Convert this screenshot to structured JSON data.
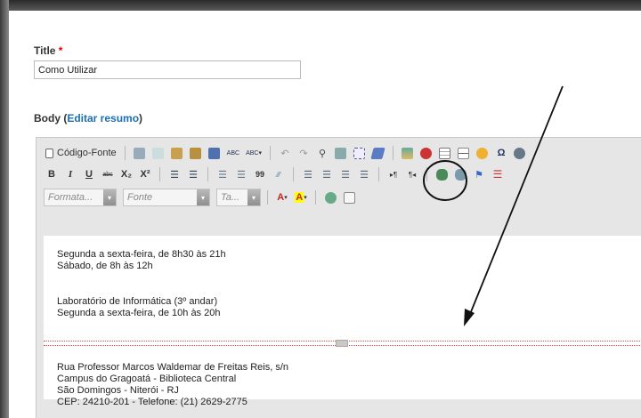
{
  "form": {
    "title_label": "Title",
    "required_mark": "*",
    "title_value": "Como Utilizar",
    "body_label": "Body",
    "edit_summary_open": "(",
    "edit_summary_link": "Editar resumo",
    "edit_summary_close": ")"
  },
  "toolbar": {
    "source_label": "Código-Fonte",
    "bold": "B",
    "italic": "I",
    "underline": "U",
    "strike": "abc",
    "subscript": "X₂",
    "superscript": "X²",
    "blockquote": "99",
    "format_combo": "Formata...",
    "font_combo": "Fonte",
    "size_combo": "Ta...",
    "text_color": "A",
    "bg_color": "A",
    "spell_1": "ABC",
    "spell_2": "ABC"
  },
  "content": {
    "line1": "Segunda a sexta-feira, de 8h30 às 21h",
    "line2": "Sábado, de 8h às 12h",
    "line3": "Laboratório de Informática (3º andar)",
    "line4": "Segunda a sexta-feira, de 10h às 20h",
    "line5": "Rua Professor Marcos Waldemar de Freitas Reis, s/n",
    "line6": "Campus do Gragoatá - Biblioteca Central",
    "line7": "São Domingos - Niterói - RJ",
    "line8": "CEP: 24210-201 - Telefone: (21) 2629-2775"
  },
  "icons": [
    "source-icon",
    "cut-icon",
    "copy-icon",
    "paste-icon",
    "paste-text-icon",
    "paste-word-icon",
    "spellcheck-icon",
    "undo-icon",
    "redo-icon",
    "find-icon",
    "replace-icon",
    "select-all-icon",
    "remove-format-icon",
    "image-icon",
    "flash-icon",
    "table-icon",
    "hr-icon",
    "smiley-icon",
    "special-char-icon",
    "iframe-icon",
    "numbered-list-icon",
    "bulleted-list-icon",
    "outdent-icon",
    "indent-icon",
    "align-left-icon",
    "align-center-icon",
    "align-right-icon",
    "justify-icon",
    "ltr-icon",
    "rtl-icon",
    "link-icon",
    "unlink-icon",
    "anchor-icon",
    "page-break-icon",
    "maximize-icon",
    "show-blocks-icon"
  ],
  "colors": {
    "required": "#e00000",
    "link": "#1a6fb5",
    "pagebreak": "#dd4444"
  }
}
